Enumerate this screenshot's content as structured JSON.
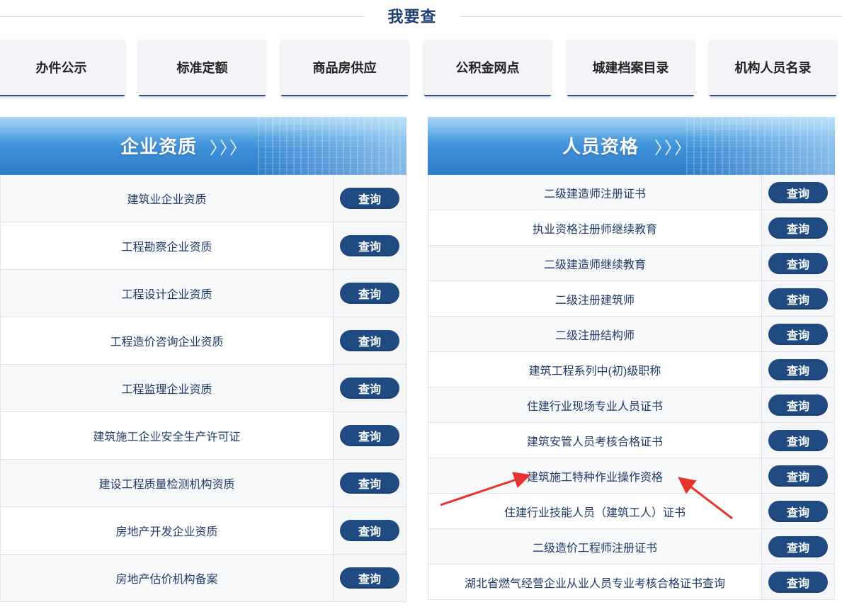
{
  "section_title": "我要查",
  "quick_links": [
    "办件公示",
    "标准定额",
    "商品房供应",
    "公积金网点",
    "城建档案目录",
    "机构人员名录"
  ],
  "left_panel": {
    "title": "企业资质",
    "arrows": "〉〉〉",
    "button_label": "查询",
    "rows": [
      "建筑业企业资质",
      "工程勘察企业资质",
      "工程设计企业资质",
      "工程造价咨询企业资质",
      "工程监理企业资质",
      "建筑施工企业安全生产许可证",
      "建设工程质量检测机构资质",
      "房地产开发企业资质",
      "房地产估价机构备案"
    ]
  },
  "right_panel": {
    "title": "人员资格",
    "arrows": "〉〉〉",
    "button_label": "查询",
    "rows": [
      "二级建造师注册证书",
      "执业资格注册师继续教育",
      "二级建造师继续教育",
      "二级注册建筑师",
      "二级注册结构师",
      "建筑工程系列中(初)级职称",
      "住建行业现场专业人员证书",
      "建筑安管人员考核合格证书",
      "建筑施工特种作业操作资格",
      "住建行业技能人员（建筑工人）证书",
      "二级造价工程师注册证书",
      "湖北省燃气经营企业从业人员专业考核合格证书查询"
    ]
  },
  "colors": {
    "brand_dark_blue": "#1f4a82",
    "banner_blue": "#3d8fd8",
    "annotation_red": "#e8322d"
  }
}
